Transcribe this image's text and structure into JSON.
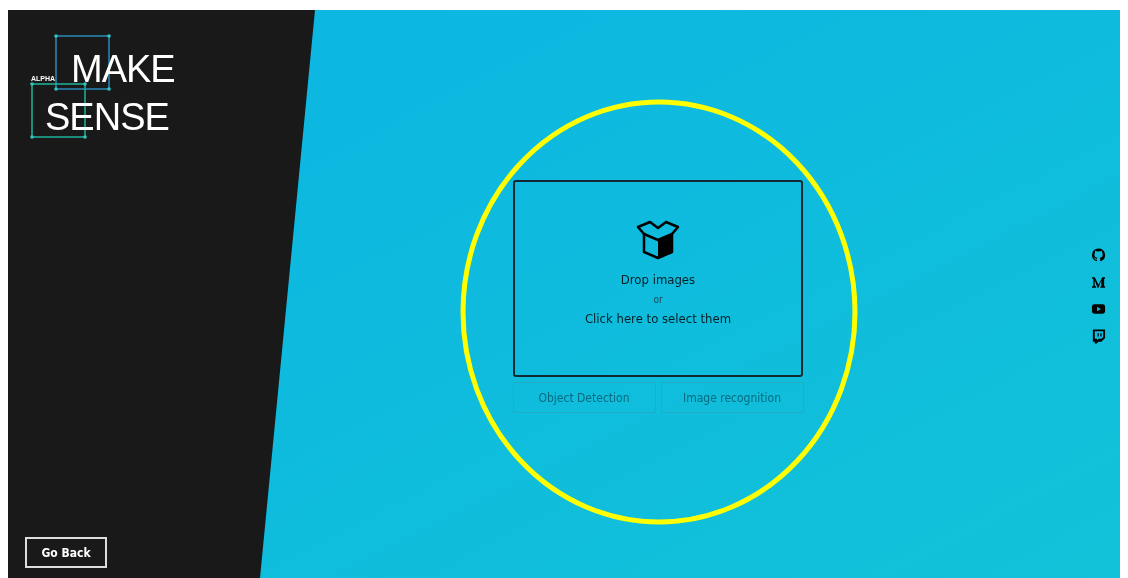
{
  "logo": {
    "tag": "ALPHA",
    "line_1": "MAKE",
    "line_2": "SENSE"
  },
  "back_button": {
    "label": "Go Back"
  },
  "dropzone": {
    "title": "Drop images",
    "separator": "or",
    "action": "Click here to select them"
  },
  "modes": [
    {
      "label": "Object Detection",
      "disabled": true
    },
    {
      "label": "Image recognition",
      "disabled": true
    }
  ],
  "social": [
    {
      "kind": "github"
    },
    {
      "kind": "medium"
    },
    {
      "kind": "youtube"
    },
    {
      "kind": "twitch"
    }
  ]
}
